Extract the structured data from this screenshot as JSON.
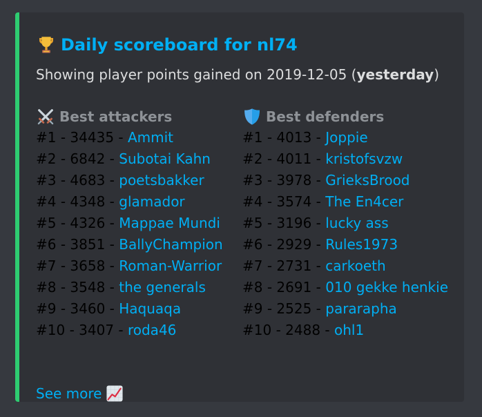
{
  "colors": {
    "background": "#36393f",
    "embed_bg": "#2f3136",
    "accent_bar": "#2ecc71",
    "link": "#00aff4",
    "text": "#dcddde",
    "header_muted": "#8e9297"
  },
  "embed": {
    "title": "Daily scoreboard for nl74",
    "title_icon": "trophy-icon",
    "description_prefix": "Showing player points gained on 2019-12-05 (",
    "description_bold": "yesterday",
    "description_suffix": ")",
    "attackers": {
      "icon": "crossed-swords-icon",
      "header": "Best attackers",
      "rows": [
        {
          "prefix": "#1 - 34435 - ",
          "name": "Ammit"
        },
        {
          "prefix": "#2 - 6842 - ",
          "name": "Subotai Kahn"
        },
        {
          "prefix": "#3 - 4683 - ",
          "name": "poetsbakker"
        },
        {
          "prefix": "#4 - 4348 - ",
          "name": "glamador"
        },
        {
          "prefix": "#5 - 4326 - ",
          "name": "Mappae Mundi"
        },
        {
          "prefix": "#6 - 3851 - ",
          "name": "BallyChampion"
        },
        {
          "prefix": "#7 - 3658 - ",
          "name": "Roman-Warrior"
        },
        {
          "prefix": "#8 - 3548 - ",
          "name": "the generals"
        },
        {
          "prefix": "#9 - 3460 - ",
          "name": "Haquaqa"
        },
        {
          "prefix": "#10 - 3407 - ",
          "name": "roda46"
        }
      ]
    },
    "defenders": {
      "icon": "shield-icon",
      "header": "Best defenders",
      "rows": [
        {
          "prefix": "#1 - 4013 - ",
          "name": "Joppie"
        },
        {
          "prefix": "#2 - 4011 - ",
          "name": "kristofsvzw"
        },
        {
          "prefix": "#3 - 3978 - ",
          "name": "GrieksBrood"
        },
        {
          "prefix": "#4 - 3574 - ",
          "name": "The En4cer"
        },
        {
          "prefix": "#5 - 3196 - ",
          "name": "lucky ass"
        },
        {
          "prefix": "#6 - 2929 - ",
          "name": "Rules1973"
        },
        {
          "prefix": "#7 - 2731 - ",
          "name": "carkoeth"
        },
        {
          "prefix": "#8 - 2691 - ",
          "name": "010 gekke henkie"
        },
        {
          "prefix": "#9 - 2525 - ",
          "name": "pararapha"
        },
        {
          "prefix": "#10 - 2488 - ",
          "name": "ohl1"
        }
      ]
    },
    "see_more": {
      "label": "See more",
      "icon": "chart-increasing-icon"
    }
  }
}
